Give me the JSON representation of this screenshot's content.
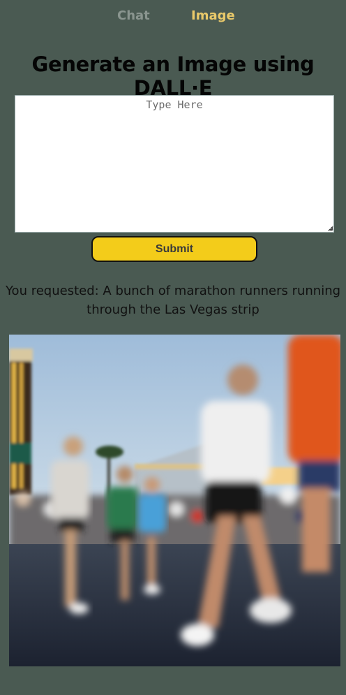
{
  "nav": {
    "tabs": [
      {
        "label": "Chat",
        "active": false
      },
      {
        "label": "Image",
        "active": true
      }
    ],
    "active_color": "#e9c96a",
    "inactive_color": "#8a958f"
  },
  "page": {
    "title": "Generate an Image using DALL·E",
    "background": "#4a5a52"
  },
  "form": {
    "prompt_placeholder": "Type Here",
    "prompt_value": "",
    "submit_label": "Submit",
    "submit_color": "#f3cc1a"
  },
  "result": {
    "requested_text": "You requested: A bunch of marathon runners running through the Las Vegas strip",
    "image_description_icon": "generated-image"
  }
}
